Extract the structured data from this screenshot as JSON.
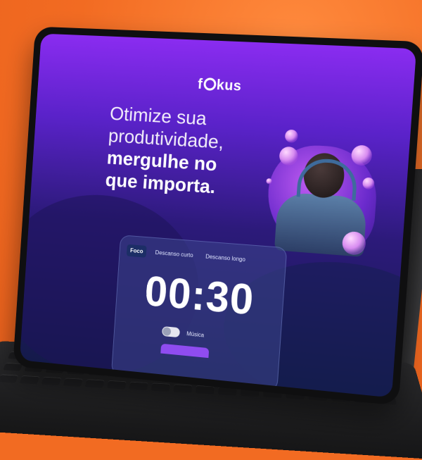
{
  "app": {
    "logo_text_left": "f",
    "logo_text_right": "kus"
  },
  "hero": {
    "headline_line1": "Otimize sua",
    "headline_line2": "produtividade,",
    "headline_line3": "mergulhe no",
    "headline_line4": "que importa."
  },
  "timer": {
    "tabs": [
      {
        "label": "Foco",
        "active": true
      },
      {
        "label": "Descanso curto",
        "active": false
      },
      {
        "label": "Descanso longo",
        "active": false
      }
    ],
    "time_display": "00:30",
    "music_label": "Música",
    "music_enabled": false
  },
  "colors": {
    "background": "#f26b22",
    "screen_top": "#8a2cf0",
    "screen_bottom": "#141a4a",
    "start_button": "#8f4cf0",
    "active_tab": "#1c2e66"
  },
  "icons": [
    "logo-ring-icon",
    "toggle-switch-icon"
  ]
}
